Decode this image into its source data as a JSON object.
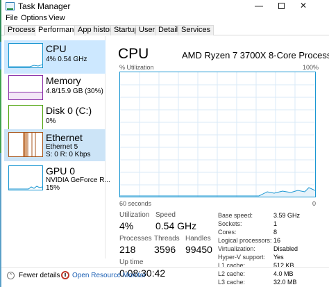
{
  "window": {
    "title": "Task Manager",
    "minimize": "—",
    "close": "✕"
  },
  "menu": [
    "File",
    "Options",
    "View"
  ],
  "tabs": [
    "Processes",
    "Performance",
    "App history",
    "Startup",
    "Users",
    "Details",
    "Services"
  ],
  "sidebar": [
    {
      "title": "CPU",
      "sub1": "4%  0.54 GHz",
      "sub2": "",
      "color": "#1996d2"
    },
    {
      "title": "Memory",
      "sub1": "4.8/15.9 GB (30%)",
      "sub2": "",
      "color": "#8b2fa8"
    },
    {
      "title": "Disk 0 (C:)",
      "sub1": "0%",
      "sub2": "",
      "color": "#4da30b"
    },
    {
      "title": "Ethernet",
      "sub1": "Ethernet 5",
      "sub2": "S: 0  R: 0 Kbps",
      "color": "#a7551c"
    },
    {
      "title": "GPU 0",
      "sub1": "NVIDIA GeForce R...",
      "sub2": "15%",
      "color": "#1996d2"
    }
  ],
  "main": {
    "title": "CPU",
    "model": "AMD Ryzen 7 3700X 8-Core Processor",
    "util_label": "% Utilization",
    "util_max": "100%",
    "graph_seconds": "60 seconds",
    "graph_zero": "0",
    "stats": {
      "utilization_label": "Utilization",
      "utilization": "4%",
      "speed_label": "Speed",
      "speed": "0.54 GHz",
      "processes_label": "Processes",
      "processes": "218",
      "threads_label": "Threads",
      "threads": "3596",
      "handles_label": "Handles",
      "handles": "99450",
      "uptime_label": "Up time",
      "uptime": "0:08:30:42"
    },
    "specs": [
      {
        "label": "Base speed:",
        "value": "3.59 GHz"
      },
      {
        "label": "Sockets:",
        "value": "1"
      },
      {
        "label": "Cores:",
        "value": "8"
      },
      {
        "label": "Logical processors:",
        "value": "16"
      },
      {
        "label": "Virtualization:",
        "value": "Disabled"
      },
      {
        "label": "Hyper-V support:",
        "value": "Yes"
      },
      {
        "label": "L1 cache:",
        "value": "512 KB"
      },
      {
        "label": "L2 cache:",
        "value": "4.0 MB"
      },
      {
        "label": "L3 cache:",
        "value": "32.0 MB"
      }
    ]
  },
  "footer": {
    "fewer": "Fewer details",
    "resource": "Open Resource Monitor"
  },
  "colors": {
    "accent": "#1996d2",
    "selected": "#cde8ff",
    "ethernet": "#a7551c",
    "memory": "#8b2fa8",
    "disk": "#4da30b"
  }
}
